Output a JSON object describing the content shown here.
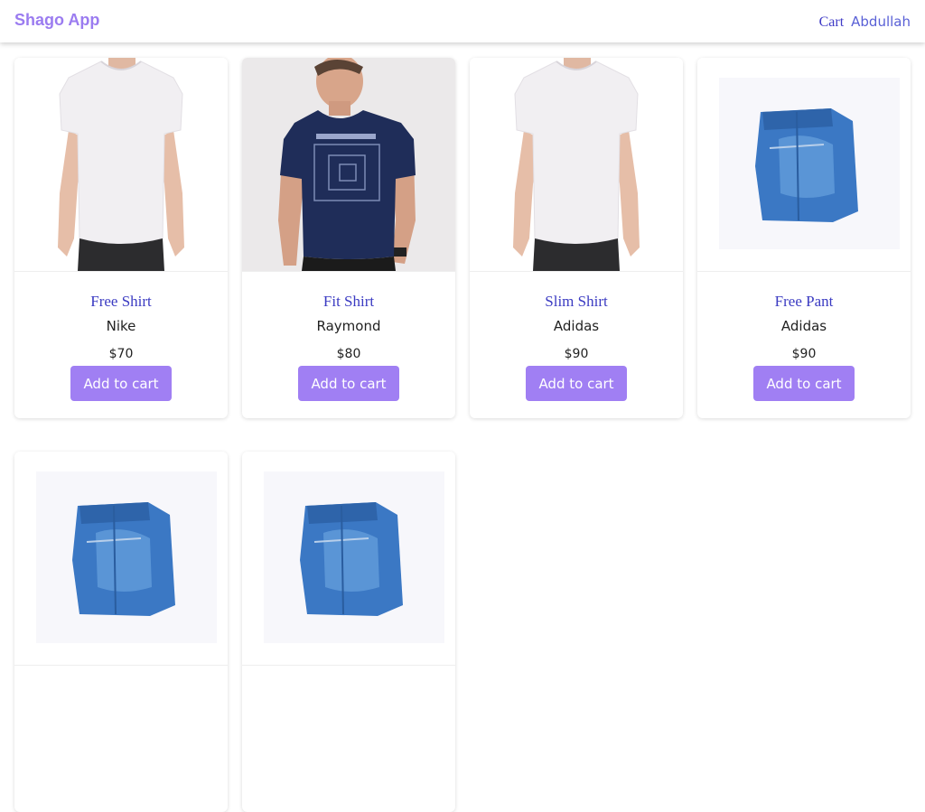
{
  "navbar": {
    "brand": "Shago App",
    "cart_label": "Cart",
    "user_name": "Abdullah"
  },
  "colors": {
    "brand": "#9b7cf0",
    "button": "#a07ff3",
    "title": "#3b3bc2"
  },
  "products": [
    {
      "title": "Free Shirt",
      "brand": "Nike",
      "price": "$70",
      "button_label": "Add to cart",
      "image": "white-tshirt-image"
    },
    {
      "title": "Fit Shirt",
      "brand": "Raymond",
      "price": "$80",
      "button_label": "Add to cart",
      "image": "navy-tshirt-image"
    },
    {
      "title": "Slim Shirt",
      "brand": "Adidas",
      "price": "$90",
      "button_label": "Add to cart",
      "image": "white-tshirt-image"
    },
    {
      "title": "Free Pant",
      "brand": "Adidas",
      "price": "$90",
      "button_label": "Add to cart",
      "image": "folded-jeans-image"
    },
    {
      "image": "folded-jeans-image"
    },
    {
      "image": "folded-jeans-image"
    }
  ]
}
